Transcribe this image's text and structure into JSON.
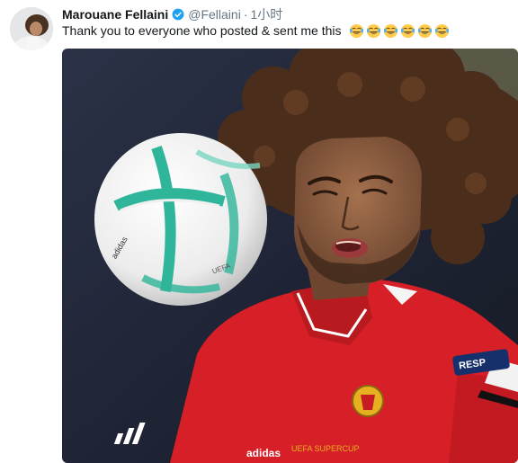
{
  "tweet": {
    "author": {
      "display_name": "Marouane Fellaini",
      "handle": "@Fellaini",
      "verified": true,
      "verified_icon": "verified-badge-icon"
    },
    "separator": "·",
    "timestamp": "1小时",
    "text": "Thank you to everyone who posted & sent me this",
    "emoji_name": "face-with-tears-of-joy-icon",
    "emoji_count": 6,
    "media": {
      "type": "photo",
      "kit_logo": "adidas",
      "badge_text": "RESP",
      "shirt_print": "UEFA SUPERCUP"
    }
  },
  "colors": {
    "name_text": "#14171a",
    "secondary_text": "#657786",
    "verified_blue": "#1da1f2",
    "shirt_red": "#d61f26"
  }
}
